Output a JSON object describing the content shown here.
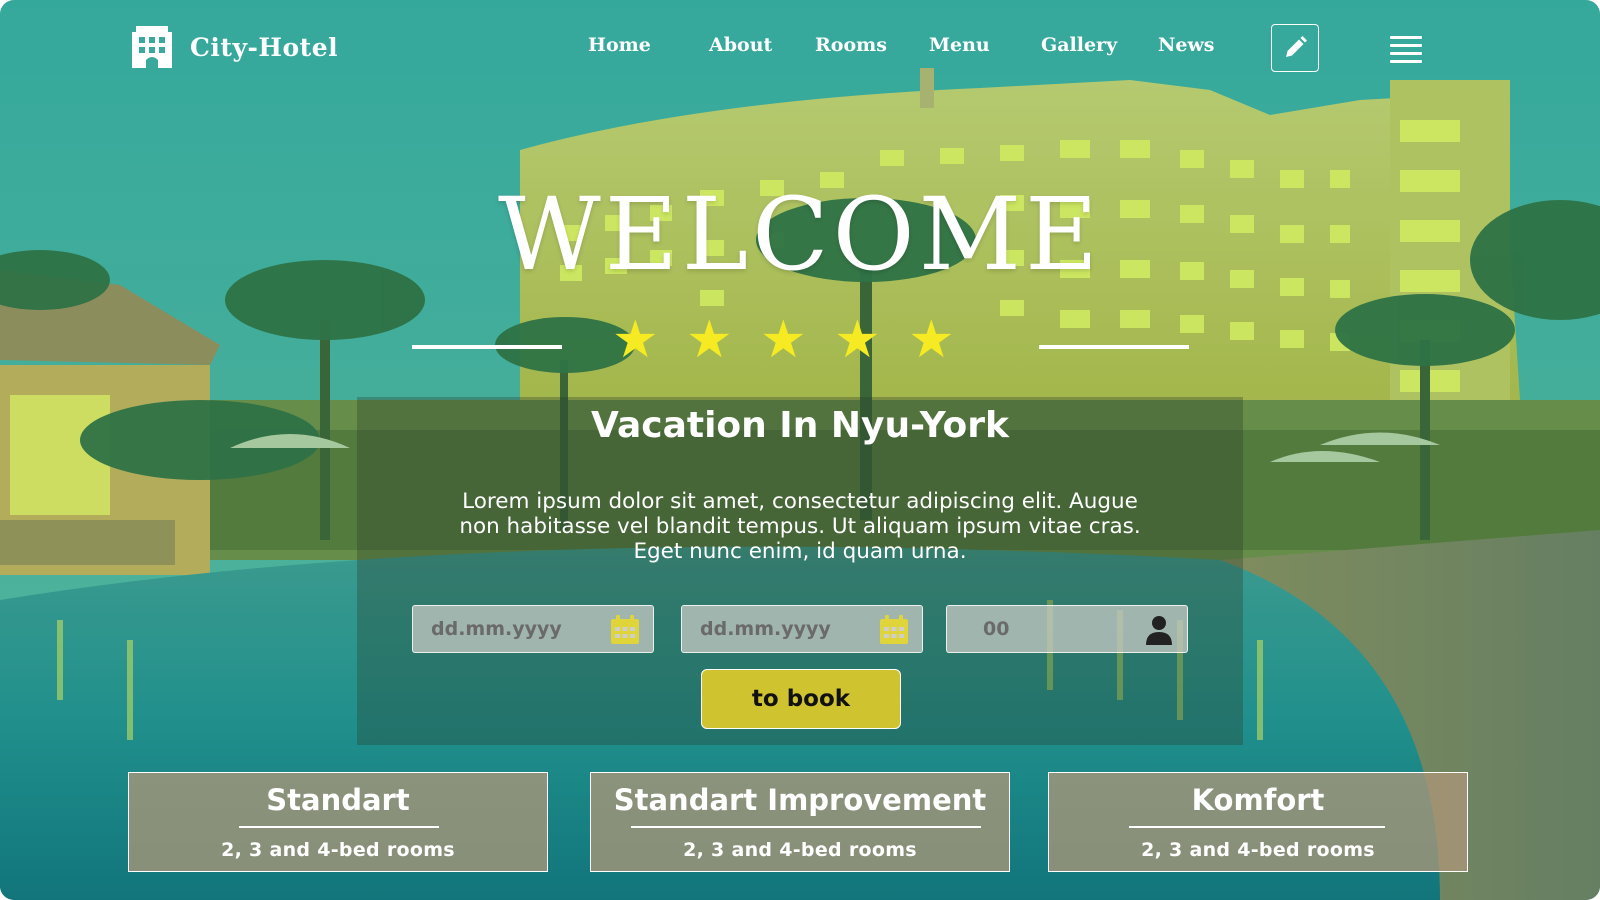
{
  "colors": {
    "accent_star": "#f6ea22",
    "button": "#cfc42f",
    "overlay_teal": "#3fb3a4"
  },
  "header": {
    "logo_icon": "hotel-building-icon",
    "brand": "City-Hotel",
    "nav": [
      "Home",
      "About",
      "Rooms",
      "Menu",
      "Gallery",
      "News"
    ],
    "edit_icon": "pencil-icon",
    "menu_icon": "hamburger-menu-icon"
  },
  "hero": {
    "heading": "WELCOME",
    "rating_stars": 5,
    "subtitle": "Vacation In Nyu-York",
    "text_lines": [
      "Lorem ipsum dolor sit amet, consectetur adipiscing elit. Augue",
      "non habitasse vel blandit tempus. Ut aliquam ipsum vitae cras.",
      "Eget nunc enim, id quam urna."
    ]
  },
  "booking": {
    "check_in_placeholder": "dd.mm.yyyy",
    "check_out_placeholder": "dd.mm.yyyy",
    "guests_placeholder": "00",
    "calendar_icon": "calendar-icon",
    "guest_icon": "user-icon",
    "submit_label": "to book"
  },
  "rooms": [
    {
      "title": "Standart",
      "subtitle": "2, 3 and 4-bed rooms"
    },
    {
      "title": "Standart Improvement",
      "subtitle": "2, 3 and 4-bed rooms"
    },
    {
      "title": "Komfort",
      "subtitle": "2, 3 and 4-bed rooms"
    }
  ]
}
